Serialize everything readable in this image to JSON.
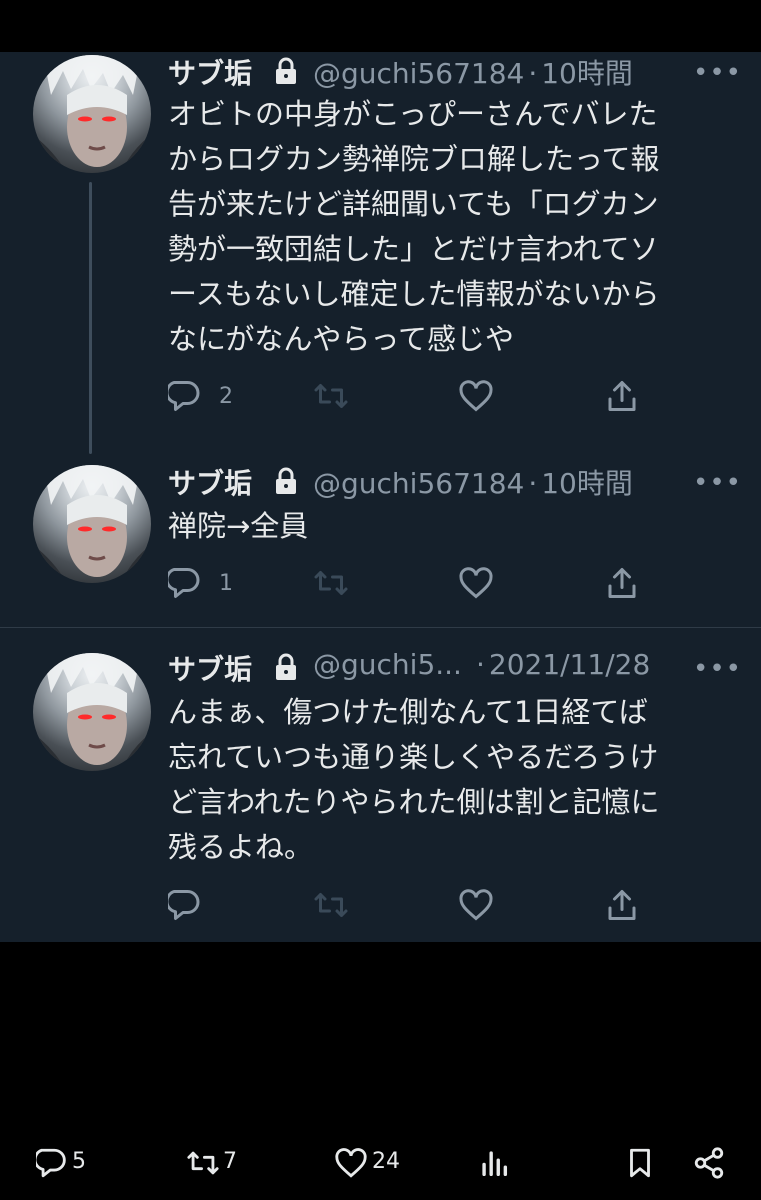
{
  "tweets": [
    {
      "display_name": "サブ垢",
      "handle": "@guchi567184",
      "time": "10時間",
      "text": "オビトの中身がこっぴーさんでバレた\nからログカン勢禅院ブロ解したって報\n告が来たけど詳細聞いても「ログカン\n勢が一致団結した」とだけ言われてソ\nースもないし確定した情報がないから\nなにがなんやらって感じや",
      "replies": "2"
    },
    {
      "display_name": "サブ垢",
      "handle": "@guchi567184",
      "time": "10時間",
      "text": "禅院→全員",
      "replies": "1"
    },
    {
      "display_name": "サブ垢",
      "handle": "@guchi5...",
      "time": "2021/11/28",
      "text": "んまぁ、傷つけた側なんて1日経てば\n忘れていつも通り楽しくやるだろうけ\nど言われたりやられた側は割と記憶に\n残るよね。",
      "replies": ""
    }
  ],
  "separator": "·",
  "more_label": "•••",
  "bottom_bar": {
    "replies": "5",
    "retweets": "7",
    "likes": "24"
  },
  "icons": [
    "lock-icon",
    "reply-icon",
    "retweet-icon",
    "like-icon",
    "share-icon",
    "more-icon",
    "analytics-icon",
    "bookmark-icon",
    "share-network-icon"
  ],
  "colors": {
    "background": "#15202b",
    "text": "#e7e9ea",
    "muted": "#8b98a5",
    "divider": "#2f3b47"
  }
}
